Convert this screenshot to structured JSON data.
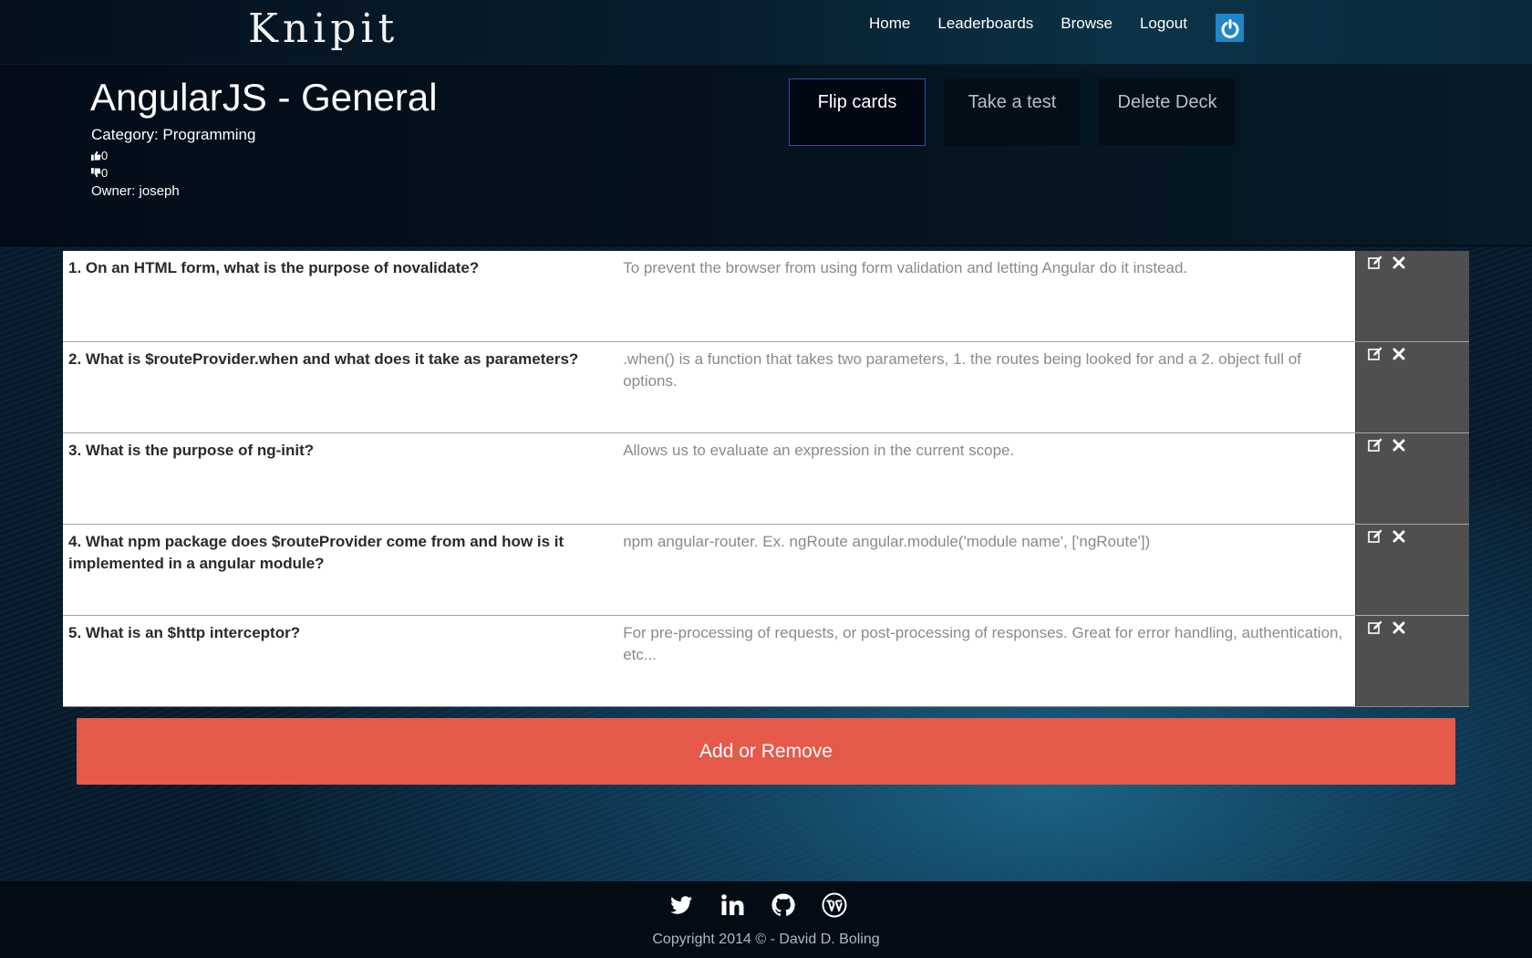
{
  "nav": {
    "brand": "Knipit",
    "links": [
      "Home",
      "Leaderboards",
      "Browse",
      "Logout"
    ],
    "power_icon": "power-icon"
  },
  "deck": {
    "title": "AngularJS - General",
    "category": "Category: Programming",
    "thumbs_up": "0",
    "thumbs_down": "0",
    "owner": "Owner: joseph",
    "buttons": [
      "Flip cards",
      "Take a test",
      "Delete Deck"
    ]
  },
  "cards": [
    {
      "question": "1. On an HTML form, what is the purpose of novalidate?",
      "answer": "To prevent the browser from using form validation and letting Angular do it instead."
    },
    {
      "question": "2. What is $routeProvider.when and what does it take as parameters?",
      "answer": ".when() is a function that takes two parameters, 1. the routes being looked for and a 2. object full of options."
    },
    {
      "question": "3. What is the purpose of ng-init?",
      "answer": "Allows us to evaluate an expression in the current scope."
    },
    {
      "question": "4. What npm package does $routeProvider come from and how is it implemented in a angular module?",
      "answer": "npm angular-router. Ex. ngRoute angular.module('module name', ['ngRoute'])"
    },
    {
      "question": "5. What is an $http interceptor?",
      "answer": "For pre-processing of requests, or post-processing of responses. Great for error handling, authentication, etc..."
    }
  ],
  "card_tools": [
    "edit-icon",
    "delete-icon"
  ],
  "add_remove_label": "Add or Remove",
  "footer": {
    "social": [
      "twitter-icon",
      "linkedin-icon",
      "github-icon",
      "wordpress-icon"
    ],
    "copyright": "Copyright 2014 © - David D. Boling"
  },
  "colors": {
    "accent_red": "#e5594a",
    "power_blue": "#1f86c8",
    "tool_panel": "#4f4f4f"
  }
}
